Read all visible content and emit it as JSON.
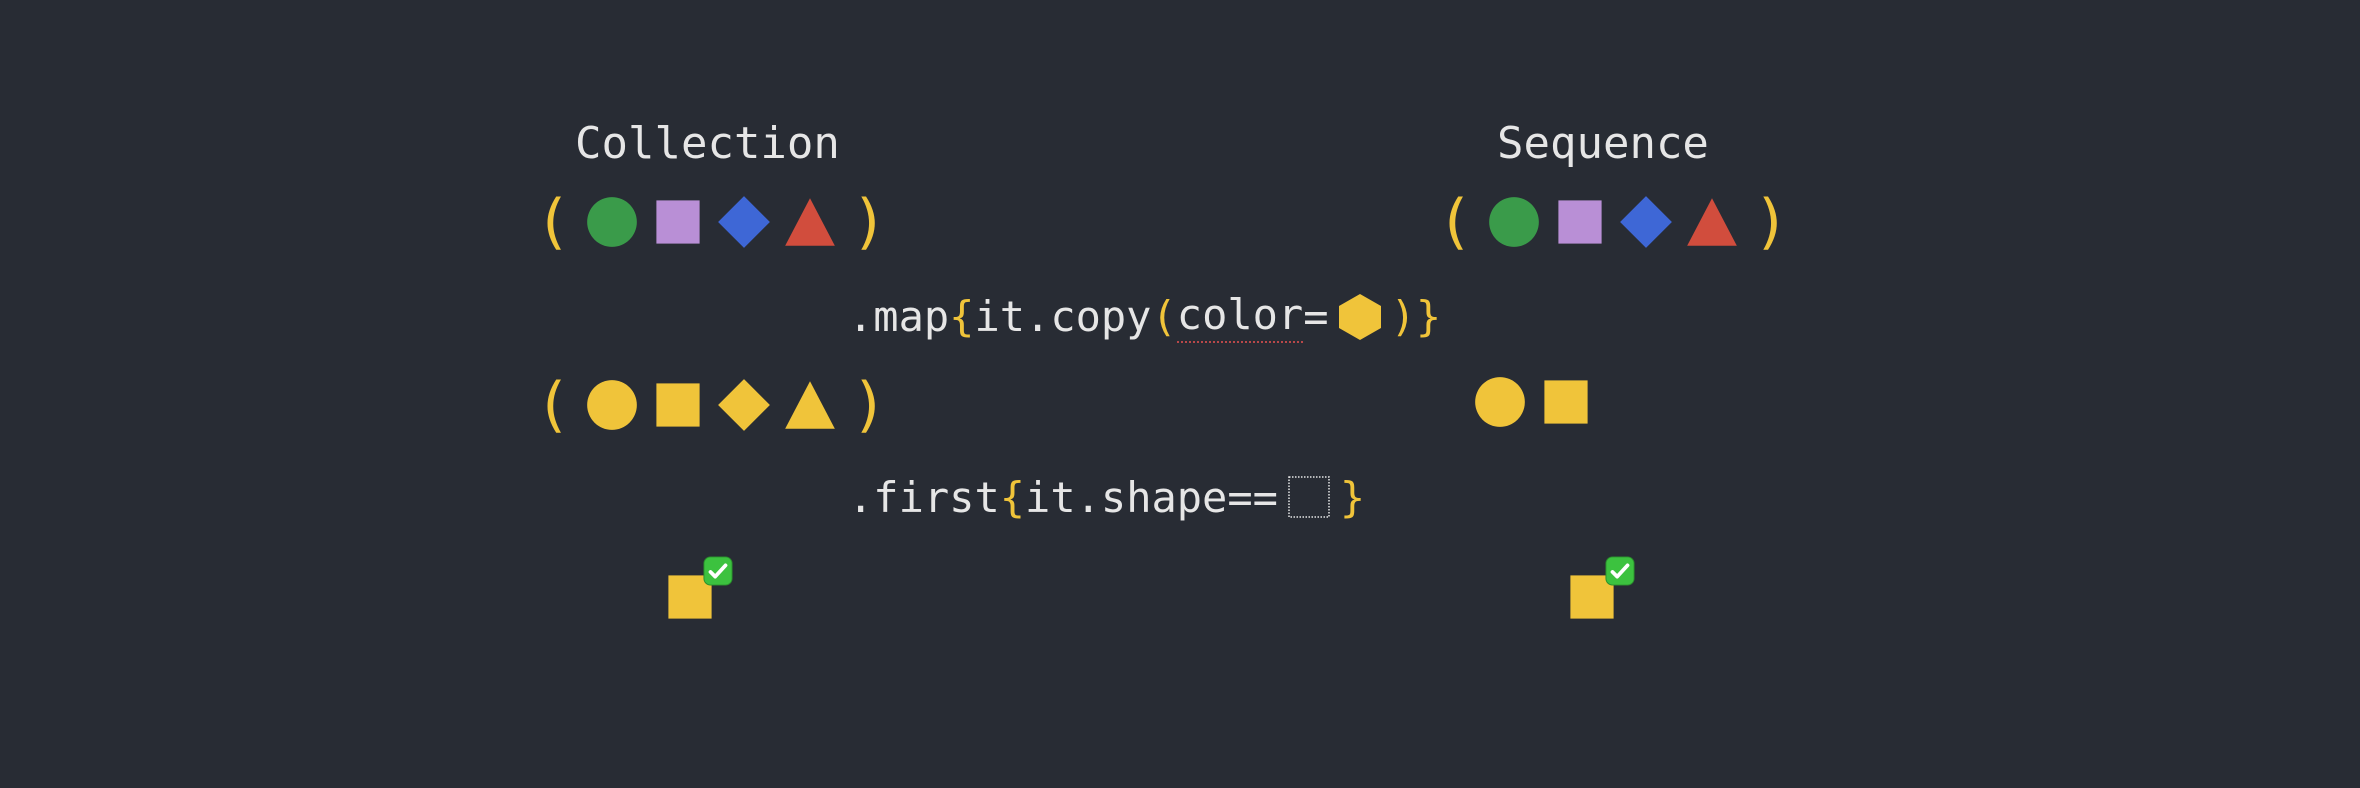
{
  "headings": {
    "collection": "Collection",
    "sequence": "Sequence"
  },
  "code": {
    "map_dot": ".",
    "map_name": "map",
    "map_open": "{ ",
    "map_it": "it",
    "map_dot2": ".",
    "map_copy": "copy",
    "map_lparen": "(",
    "map_arg": "color",
    "map_eq": " = ",
    "map_rparen": ")",
    "map_close": "}",
    "first_dot": ".",
    "first_name": "first",
    "first_open": "{ ",
    "first_it": "it",
    "first_dot2": ".",
    "first_prop": "shape",
    "first_eq": " == ",
    "first_close": "}"
  },
  "colors": {
    "green": "#3a9b4a",
    "purple": "#b98fd6",
    "blue": "#3e67d6",
    "red": "#d14d3d",
    "yellow": "#f0c43a",
    "checkGreen": "#3cc23f",
    "outline": "#e6e6e6"
  },
  "shapes": {
    "input_set": [
      {
        "shape": "circle",
        "colorKey": "green"
      },
      {
        "shape": "square",
        "colorKey": "purple"
      },
      {
        "shape": "diamond",
        "colorKey": "blue"
      },
      {
        "shape": "triangle",
        "colorKey": "red"
      }
    ],
    "collection_mapped": [
      {
        "shape": "circle",
        "colorKey": "yellow"
      },
      {
        "shape": "square",
        "colorKey": "yellow"
      },
      {
        "shape": "diamond",
        "colorKey": "yellow"
      },
      {
        "shape": "triangle",
        "colorKey": "yellow"
      }
    ],
    "sequence_mapped": [
      {
        "shape": "circle",
        "colorKey": "yellow"
      },
      {
        "shape": "square",
        "colorKey": "yellow"
      }
    ],
    "map_target": {
      "shape": "hexagon",
      "colorKey": "yellow"
    },
    "first_target": {
      "shape": "square",
      "outline": true
    },
    "result": {
      "shape": "square",
      "colorKey": "yellow"
    }
  }
}
